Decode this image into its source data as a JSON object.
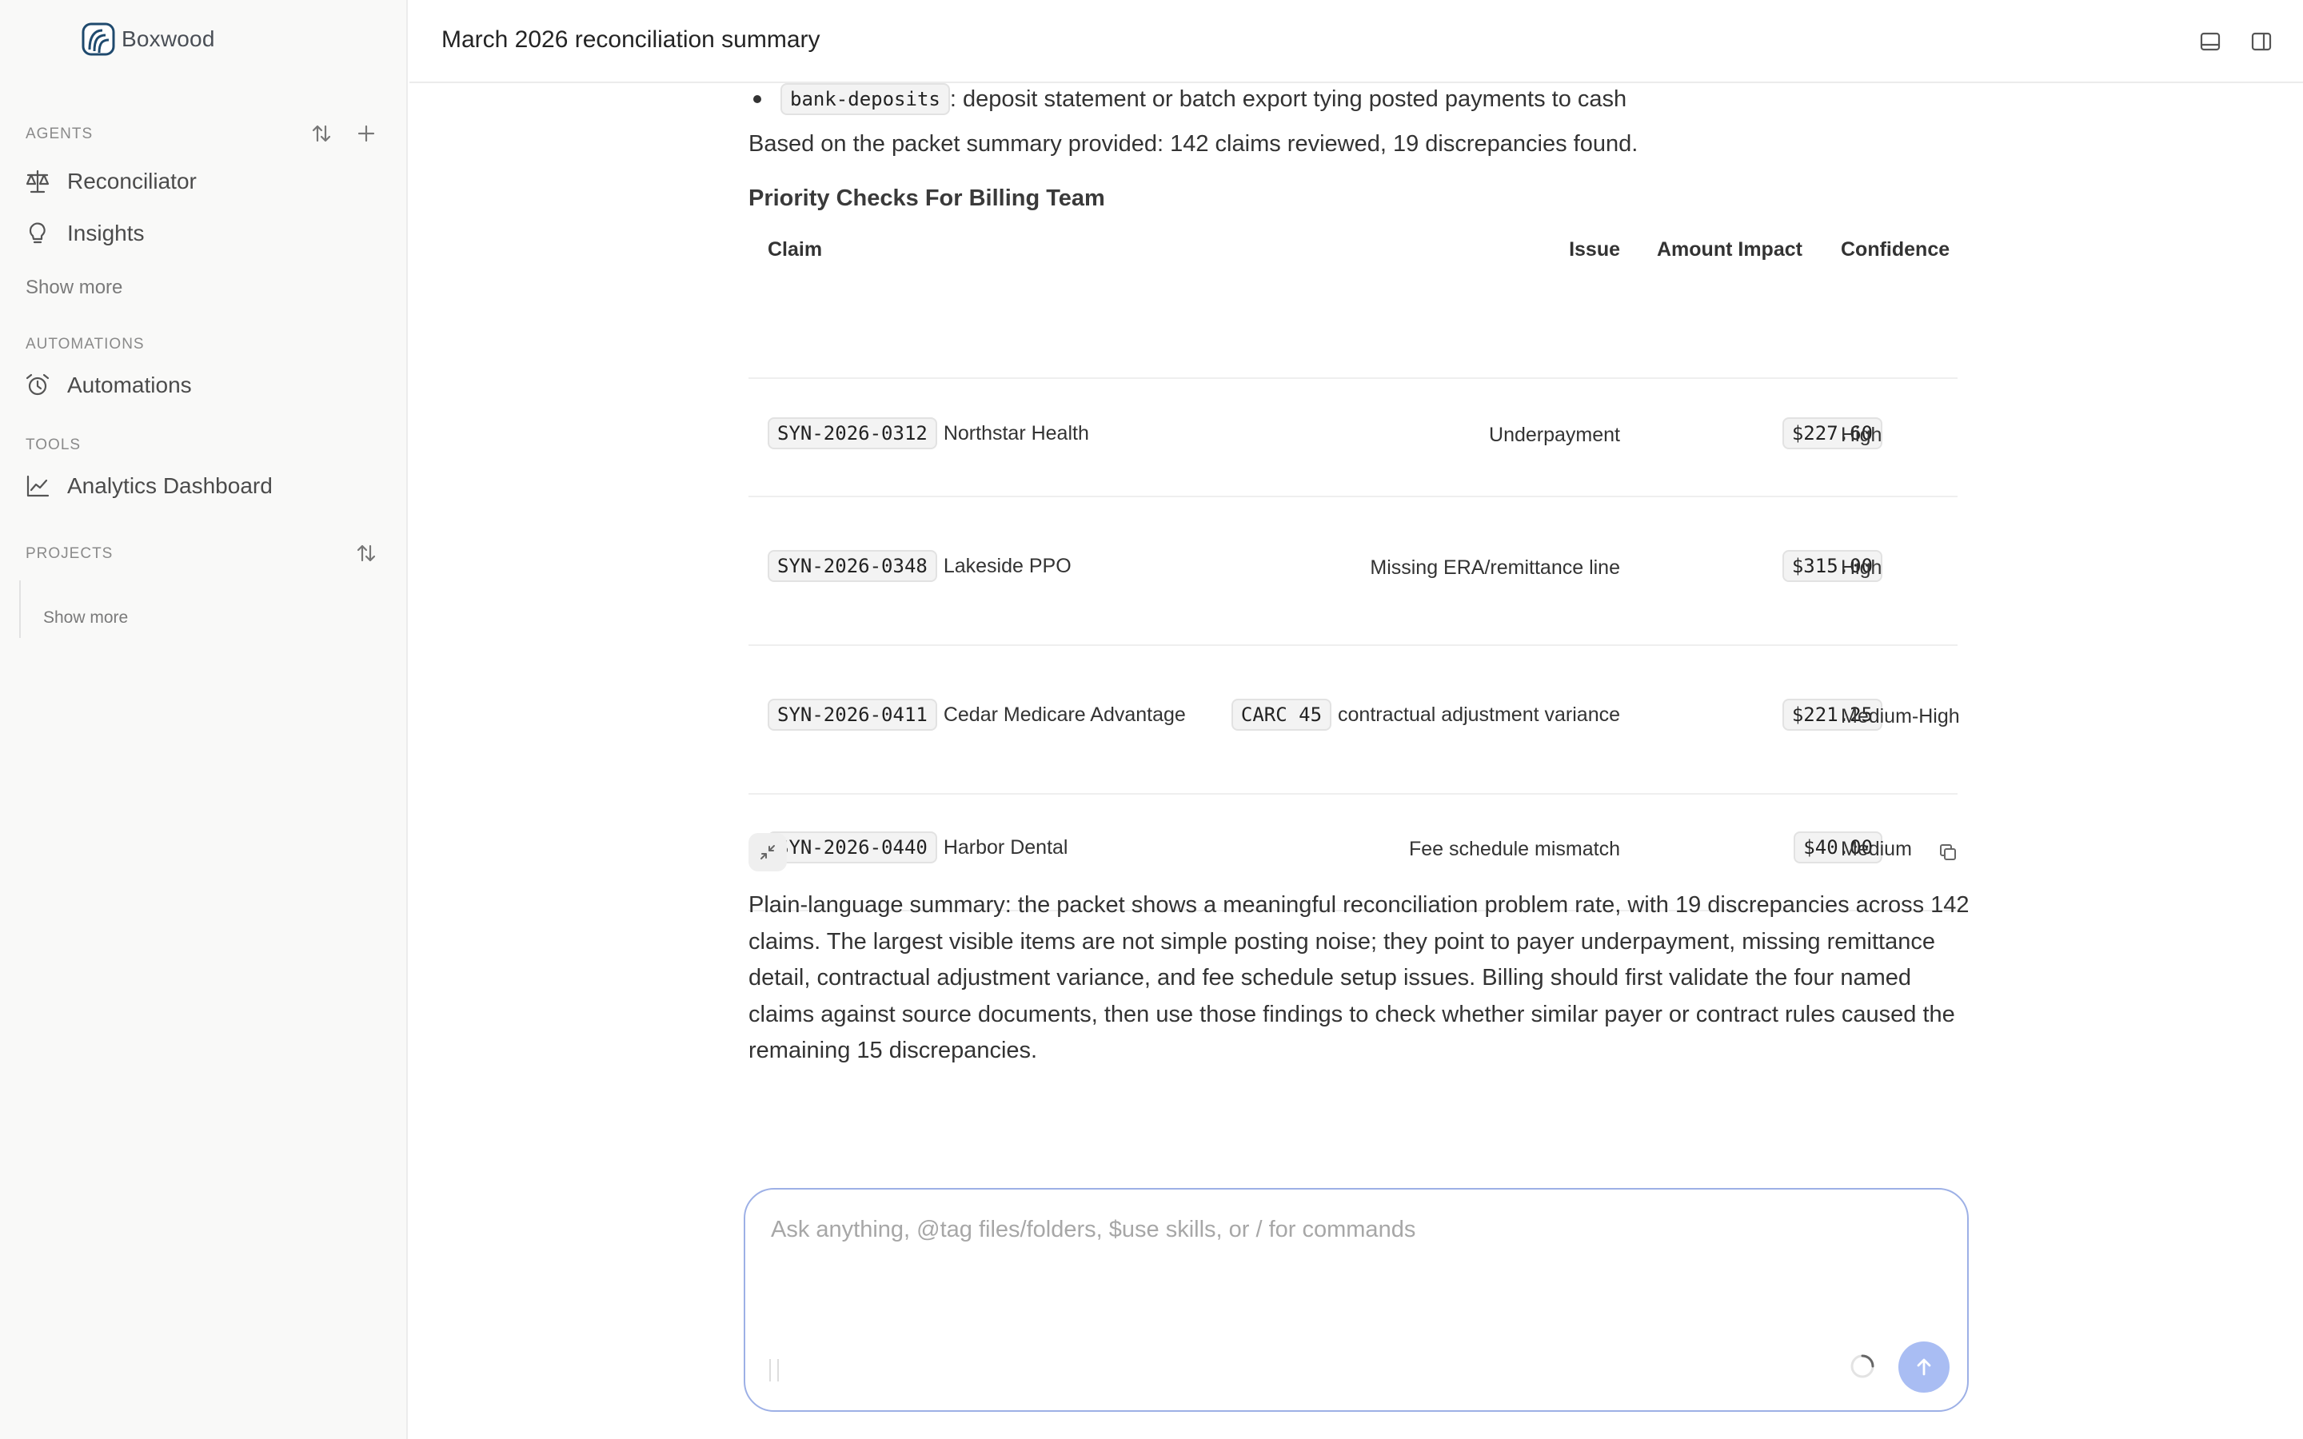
{
  "app": {
    "name": "Boxwood"
  },
  "sidebar": {
    "agents_label": "AGENTS",
    "agents": [
      {
        "label": "Reconciliator",
        "icon": "scale-icon"
      },
      {
        "label": "Insights",
        "icon": "lightbulb-icon"
      }
    ],
    "agents_show_more": "Show more",
    "automations_label": "AUTOMATIONS",
    "automations": [
      {
        "label": "Automations",
        "icon": "alarm-clock-icon"
      }
    ],
    "tools_label": "TOOLS",
    "tools": [
      {
        "label": "Analytics Dashboard",
        "icon": "line-chart-icon"
      }
    ],
    "projects_label": "PROJECTS",
    "projects_show_more": "Show more"
  },
  "header": {
    "title": "March 2026 reconciliation summary"
  },
  "content": {
    "bullet": {
      "code": "bank-deposits",
      "text": ": deposit statement or batch export tying posted payments to cash"
    },
    "packet_summary": "Based on the packet summary provided: 142 claims reviewed, 19 discrepancies found.",
    "heading": "Priority Checks For Billing Team",
    "table": {
      "columns": [
        "Claim",
        "Issue",
        "Amount Impact",
        "Confidence"
      ],
      "rows": [
        {
          "claim_id": "SYN-2026-0312",
          "payer": "Northstar Health",
          "issue_code": "",
          "issue": "Underpayment",
          "amount": "$227.60",
          "confidence": "High"
        },
        {
          "claim_id": "SYN-2026-0348",
          "payer": "Lakeside PPO",
          "issue_code": "",
          "issue": "Missing ERA/remittance line",
          "amount": "$315.00",
          "confidence": "High"
        },
        {
          "claim_id": "SYN-2026-0411",
          "payer": "Cedar Medicare Advantage",
          "issue_code": "CARC 45",
          "issue": "contractual adjustment variance",
          "amount": "$221.25",
          "confidence": "Medium-High"
        },
        {
          "claim_id": "SYN-2026-0440",
          "payer": "Harbor Dental",
          "issue_code": "",
          "issue": "Fee schedule mismatch",
          "amount": "$40.00",
          "confidence": "Medium"
        }
      ]
    },
    "summary": "Plain-language summary: the packet shows a meaningful reconciliation problem rate, with 19 discrepancies across 142 claims. The largest visible items are not simple posting noise; they point to payer underpayment, missing remittance detail, contractual adjustment variance, and fee schedule setup issues. Billing should first validate the four named claims against source documents, then use those findings to check whether similar payer or contract rules caused the remaining 15 discrepancies."
  },
  "composer": {
    "placeholder": "Ask anything, @tag files/folders, $use skills, or / for commands",
    "value": ""
  },
  "colors": {
    "accent": "#a9bdf3",
    "composer_border": "#9db0e6",
    "brand": "#1f4a6e"
  }
}
